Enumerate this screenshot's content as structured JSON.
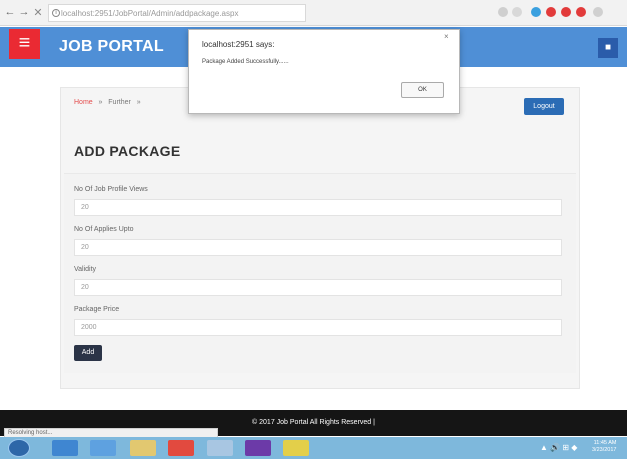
{
  "browser": {
    "url": "localhost:2951/JobPortal/Admin/addpackage.aspx",
    "back": "←",
    "forward": "→",
    "close": "✕",
    "zoom_icon": "search-icon",
    "star_icon": "star-icon"
  },
  "header": {
    "menu_icon": "≡",
    "brand": "JOB PORTAL",
    "right_icon": "■"
  },
  "breadcrumb": {
    "home": "Home",
    "sep1": "»",
    "second": "Further",
    "sep2": "»"
  },
  "logout_label": "Logout",
  "page_title": "ADD PACKAGE",
  "form": {
    "fields": [
      {
        "label": "No Of Job Profile Views",
        "value": "20"
      },
      {
        "label": "No Of Applies Upto",
        "value": "20"
      },
      {
        "label": "Validity",
        "value": "20"
      },
      {
        "label": "Package Price",
        "value": "2000"
      }
    ],
    "submit_label": "Add"
  },
  "footer_text": "© 2017 Job Portal All Rights Reserved |",
  "status_text": "Resolving host...",
  "alert": {
    "title": "localhost:2951 says:",
    "message": "Package Added Successfully......",
    "ok_label": "OK",
    "close": "×"
  },
  "taskbar": {
    "clock_time": "11:45 AM",
    "clock_date": "3/23/2017",
    "tray": "▲ 🔊 ⊞ ◆"
  },
  "colors": {
    "header": "#4f8fd6",
    "menu_button": "#ea2a33",
    "logout": "#2b6cb5",
    "add_button": "#2b3447",
    "footer": "#151515"
  }
}
